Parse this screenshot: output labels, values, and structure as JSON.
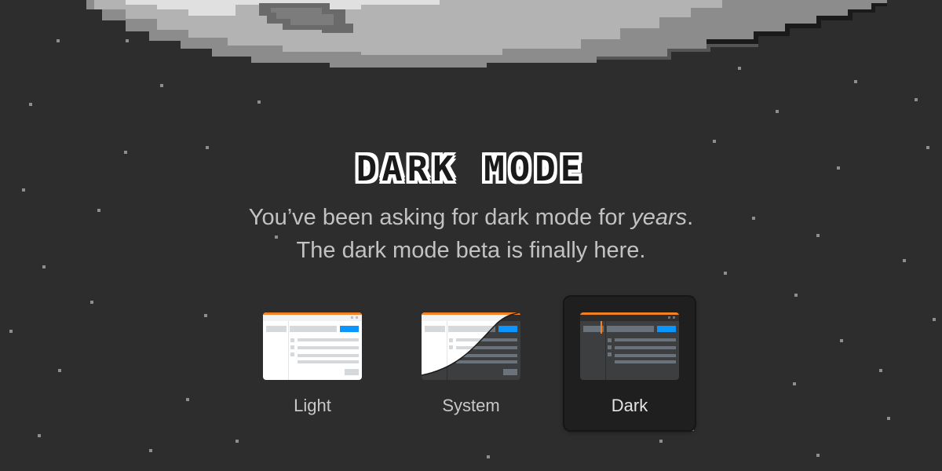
{
  "hero": {
    "title": "DARK MODE",
    "subtitle_line1_prefix": "You’ve been asking for dark mode for ",
    "subtitle_line1_emphasis": "years",
    "subtitle_line1_suffix": ".",
    "subtitle_line2": "The dark mode beta is finally here."
  },
  "theme_options": [
    {
      "label": "Light",
      "selected": false
    },
    {
      "label": "System",
      "selected": false
    },
    {
      "label": "Dark",
      "selected": true
    }
  ],
  "colors": {
    "background": "#2d2d2d",
    "accent_orange": "#f48024",
    "accent_blue": "#0a95ff"
  }
}
